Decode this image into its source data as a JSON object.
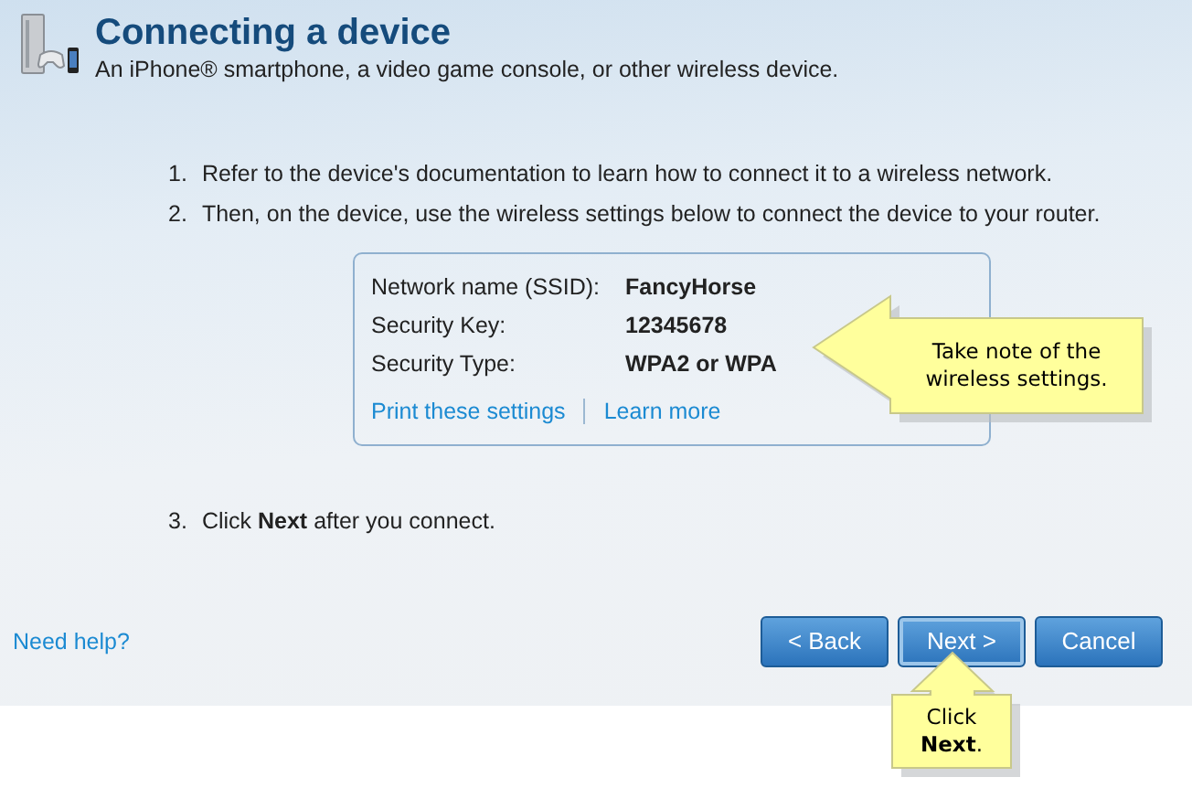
{
  "header": {
    "title": "Connecting a device",
    "subtitle": "An iPhone® smartphone, a video game console, or other wireless device."
  },
  "steps": [
    {
      "number": "1.",
      "text": "Refer to the device's documentation to learn how to connect it to a wireless network."
    },
    {
      "number": "2.",
      "text": "Then, on the device, use the wireless settings below to connect the device to your router.",
      "settings": [
        {
          "label": "Network name (SSID):",
          "value": "FancyHorse"
        },
        {
          "label": "Security Key:",
          "value": "12345678"
        },
        {
          "label": "Security Type:",
          "value": "WPA2 or WPA"
        }
      ],
      "links": [
        "Print these settings",
        "Learn more"
      ]
    },
    {
      "number": "3.",
      "text": "Click **Next** after you connect."
    }
  ],
  "help_link": "Need help?",
  "buttons": [
    {
      "label": "< Back",
      "selected": false
    },
    {
      "label": "Next >",
      "selected": true
    },
    {
      "label": "Cancel",
      "selected": false
    }
  ],
  "callouts": [
    {
      "kind": "left",
      "text": "Take note of the wireless settings."
    },
    {
      "kind": "up",
      "text": "Click **Next**."
    }
  ]
}
